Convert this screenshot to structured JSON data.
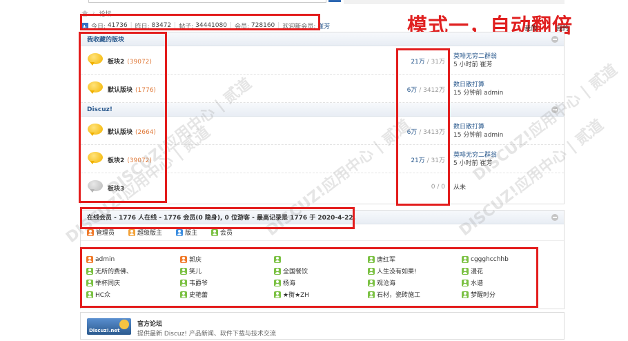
{
  "breadcrumb": {
    "current": "论坛"
  },
  "stats": {
    "today_label": "今日:",
    "today": "41736",
    "yesterday_label": "昨日:",
    "yesterday": "83472",
    "posts_label": "帖子:",
    "posts": "34441080",
    "members_label": "会员:",
    "members": "728160",
    "welcome_label": "欢迎新会员:",
    "new_member": "崔芳"
  },
  "annotation": {
    "title": "模式一，自动翻倍",
    "sub1": "我的",
    "sub2": "我的"
  },
  "categories": [
    {
      "name": "我收藏的版块",
      "forums": [
        {
          "name": "板块2",
          "count": "(39072)",
          "threads": "21万",
          "posts": "31万",
          "last_title": "莫啡无穷二群翁",
          "last_meta": "5 小时前 崔芳",
          "icon": "new"
        },
        {
          "name": "默认版块",
          "count": "(1776)",
          "threads": "6万",
          "posts": "3412万",
          "last_title": "数日散打算",
          "last_meta": "15 分钟前 admin",
          "icon": "new"
        }
      ]
    },
    {
      "name": "Discuz!",
      "forums": [
        {
          "name": "默认版块",
          "count": "(2664)",
          "threads": "6万",
          "posts": "3413万",
          "last_title": "数日散打算",
          "last_meta": "15 分钟前 admin",
          "icon": "new"
        },
        {
          "name": "板块2",
          "count": "(39072)",
          "threads": "21万",
          "posts": "31万",
          "last_title": "莫啡无穷二群翁",
          "last_meta": "5 小时前 崔芳",
          "icon": "new"
        },
        {
          "name": "板块3",
          "count": "",
          "threads": "0",
          "posts": "0",
          "last_title": "从未",
          "last_meta": "",
          "icon": "old"
        }
      ]
    }
  ],
  "online": {
    "header": "在线会员 - 1776 人在线 - 1776 会员(0 隐身), 0 位游客 - 最高记录是 1776 于 2020-4-22.",
    "legend": [
      {
        "label": "管理员",
        "role": "admin"
      },
      {
        "label": "超级版主",
        "role": "super"
      },
      {
        "label": "版主",
        "role": "mod"
      },
      {
        "label": "会员",
        "role": "member"
      }
    ],
    "users": [
      {
        "name": "admin",
        "role": "admin"
      },
      {
        "name": "郭庆",
        "role": "admin"
      },
      {
        "name": "",
        "role": "member"
      },
      {
        "name": "唐红军",
        "role": "member"
      },
      {
        "name": "cggghcchhb",
        "role": "member"
      },
      {
        "name": "无所的费佛、",
        "role": "member"
      },
      {
        "name": "笑儿",
        "role": "member"
      },
      {
        "name": "全国餐饮",
        "role": "member"
      },
      {
        "name": "人生没有如果!",
        "role": "member"
      },
      {
        "name": "漫花",
        "role": "member"
      },
      {
        "name": "举杯同庆",
        "role": "member"
      },
      {
        "name": "韦爵爷",
        "role": "member"
      },
      {
        "name": "杨海",
        "role": "member"
      },
      {
        "name": "观沧海",
        "role": "member"
      },
      {
        "name": "水谱",
        "role": "member"
      },
      {
        "name": "HC众",
        "role": "member"
      },
      {
        "name": "史艳蕾",
        "role": "member"
      },
      {
        "name": "★衡★ZH",
        "role": "member"
      },
      {
        "name": "石材，瓷砖施工",
        "role": "member"
      },
      {
        "name": "梦醒时分",
        "role": "member"
      }
    ]
  },
  "official": {
    "logo_text": "Discuz!.net",
    "title": "官方论坛",
    "desc": "提供最新 Discuz! 产品新闻、软件下载与技术交流"
  },
  "watermark": "DISCUZ!应用中心 | 贰道"
}
